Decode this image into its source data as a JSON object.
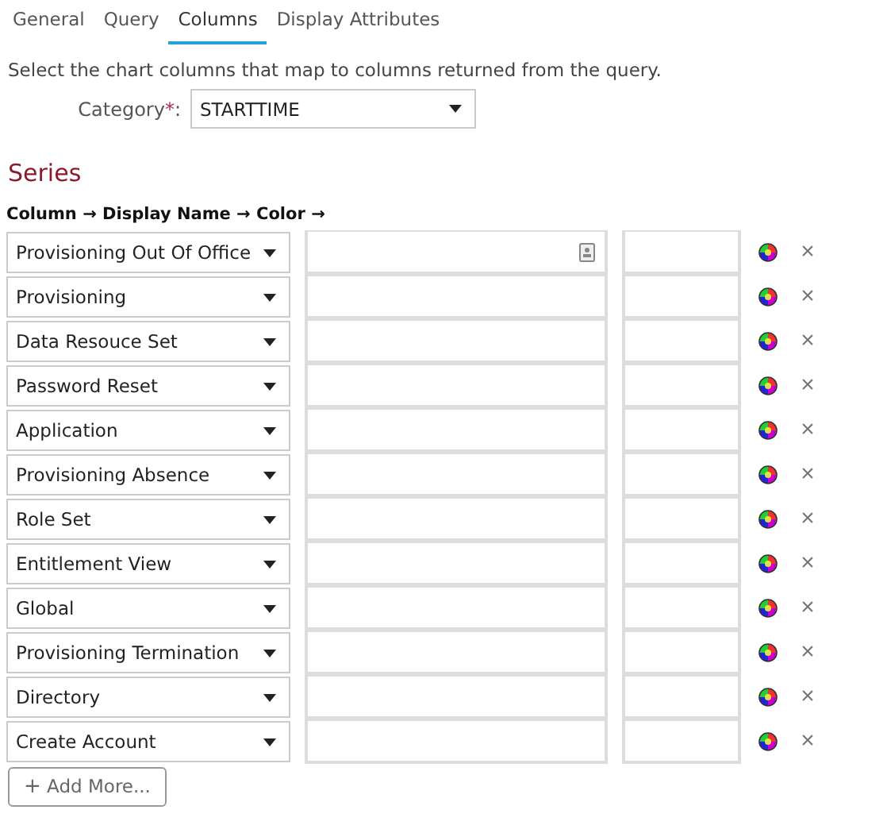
{
  "tabs": [
    {
      "label": "General",
      "selected": false
    },
    {
      "label": "Query",
      "selected": false
    },
    {
      "label": "Columns",
      "selected": true
    },
    {
      "label": "Display Attributes",
      "selected": false
    }
  ],
  "description": "Select the chart columns that map to columns returned from the query.",
  "category": {
    "label": "Category",
    "required_mark": "*",
    "suffix": ":",
    "value": "STARTTIME"
  },
  "series_title": "Series",
  "series_header": "Column → Display Name → Color →",
  "rows": [
    {
      "column": "Provisioning Out Of Office",
      "card_icon": true,
      "remove": "×"
    },
    {
      "column": "Provisioning",
      "card_icon": false,
      "remove": "×"
    },
    {
      "column": "Data Resouce Set",
      "card_icon": false,
      "remove": "×"
    },
    {
      "column": "Password Reset",
      "card_icon": false,
      "remove": "×"
    },
    {
      "column": "Application",
      "card_icon": false,
      "remove": "×"
    },
    {
      "column": "Provisioning Absence",
      "card_icon": false,
      "remove": "×"
    },
    {
      "column": "Role Set",
      "card_icon": false,
      "remove": "×"
    },
    {
      "column": "Entitlement View",
      "card_icon": false,
      "remove": "×"
    },
    {
      "column": "Global",
      "card_icon": false,
      "remove": "×"
    },
    {
      "column": "Provisioning Termination",
      "card_icon": false,
      "remove": "×"
    },
    {
      "column": "Directory",
      "card_icon": false,
      "remove": "×"
    },
    {
      "column": "Create Account",
      "card_icon": false,
      "remove": "×"
    }
  ],
  "add_button": {
    "icon": "+",
    "label": "Add More..."
  }
}
